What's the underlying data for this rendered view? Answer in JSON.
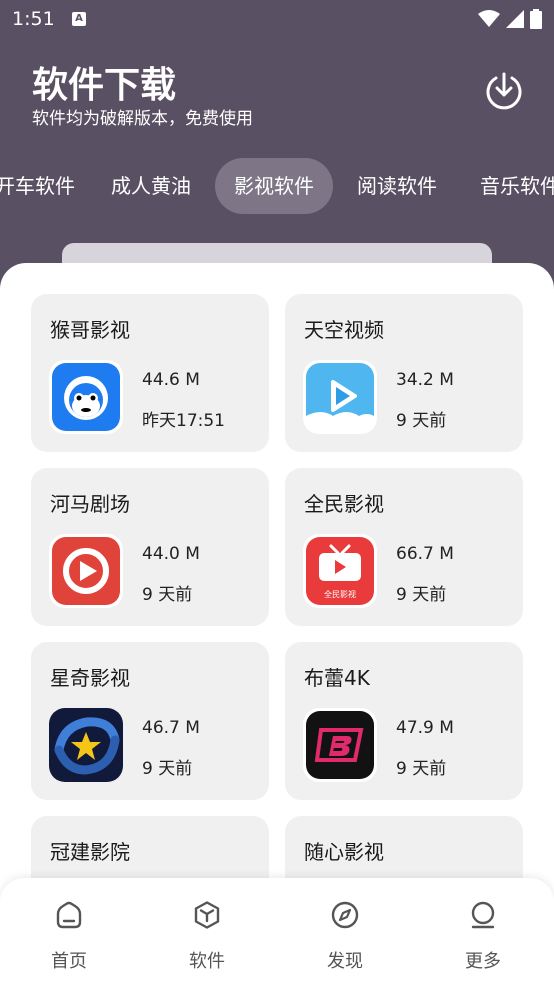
{
  "status_bar": {
    "time": "1:51",
    "notification_icon": "a-box-icon",
    "wifi_icon": "wifi-icon",
    "signal_icon": "signal-icon",
    "battery_icon": "battery-icon"
  },
  "header": {
    "title": "软件下载",
    "subtitle": "软件均为破解版本，免费使用",
    "download_icon": "download-circle-icon"
  },
  "tabs": [
    {
      "label": "开车软件",
      "active": false
    },
    {
      "label": "成人黄油",
      "active": false
    },
    {
      "label": "影视软件",
      "active": true
    },
    {
      "label": "阅读软件",
      "active": false
    },
    {
      "label": "音乐软件",
      "active": false
    }
  ],
  "apps": [
    {
      "name": "猴哥影视",
      "size": "44.6 M",
      "date": "昨天17:51",
      "icon": "monkey-icon"
    },
    {
      "name": "天空视频",
      "size": "34.2 M",
      "date": "9 天前",
      "icon": "sky-play-icon"
    },
    {
      "name": "河马剧场",
      "size": "44.0 M",
      "date": "9 天前",
      "icon": "hippo-play-icon"
    },
    {
      "name": "全民影视",
      "size": "66.7 M",
      "date": "9 天前",
      "icon": "tv-play-icon"
    },
    {
      "name": "星奇影视",
      "size": "46.7 M",
      "date": "9 天前",
      "icon": "star-icon"
    },
    {
      "name": "布蕾4K",
      "size": "47.9 M",
      "date": "9 天前",
      "icon": "b-logo-icon"
    },
    {
      "name": "冠建影院",
      "size": "",
      "date": "",
      "icon": ""
    },
    {
      "name": "随心影视",
      "size": "",
      "date": "",
      "icon": ""
    }
  ],
  "icon_texts": {
    "quanmin": "全民影视"
  },
  "bottom_nav": [
    {
      "label": "首页",
      "icon": "home-icon"
    },
    {
      "label": "软件",
      "icon": "box-icon"
    },
    {
      "label": "发现",
      "icon": "compass-icon"
    },
    {
      "label": "更多",
      "icon": "user-icon"
    }
  ],
  "colors": {
    "header_bg": "#5a5064",
    "card_bg": "#f0f0f0"
  }
}
